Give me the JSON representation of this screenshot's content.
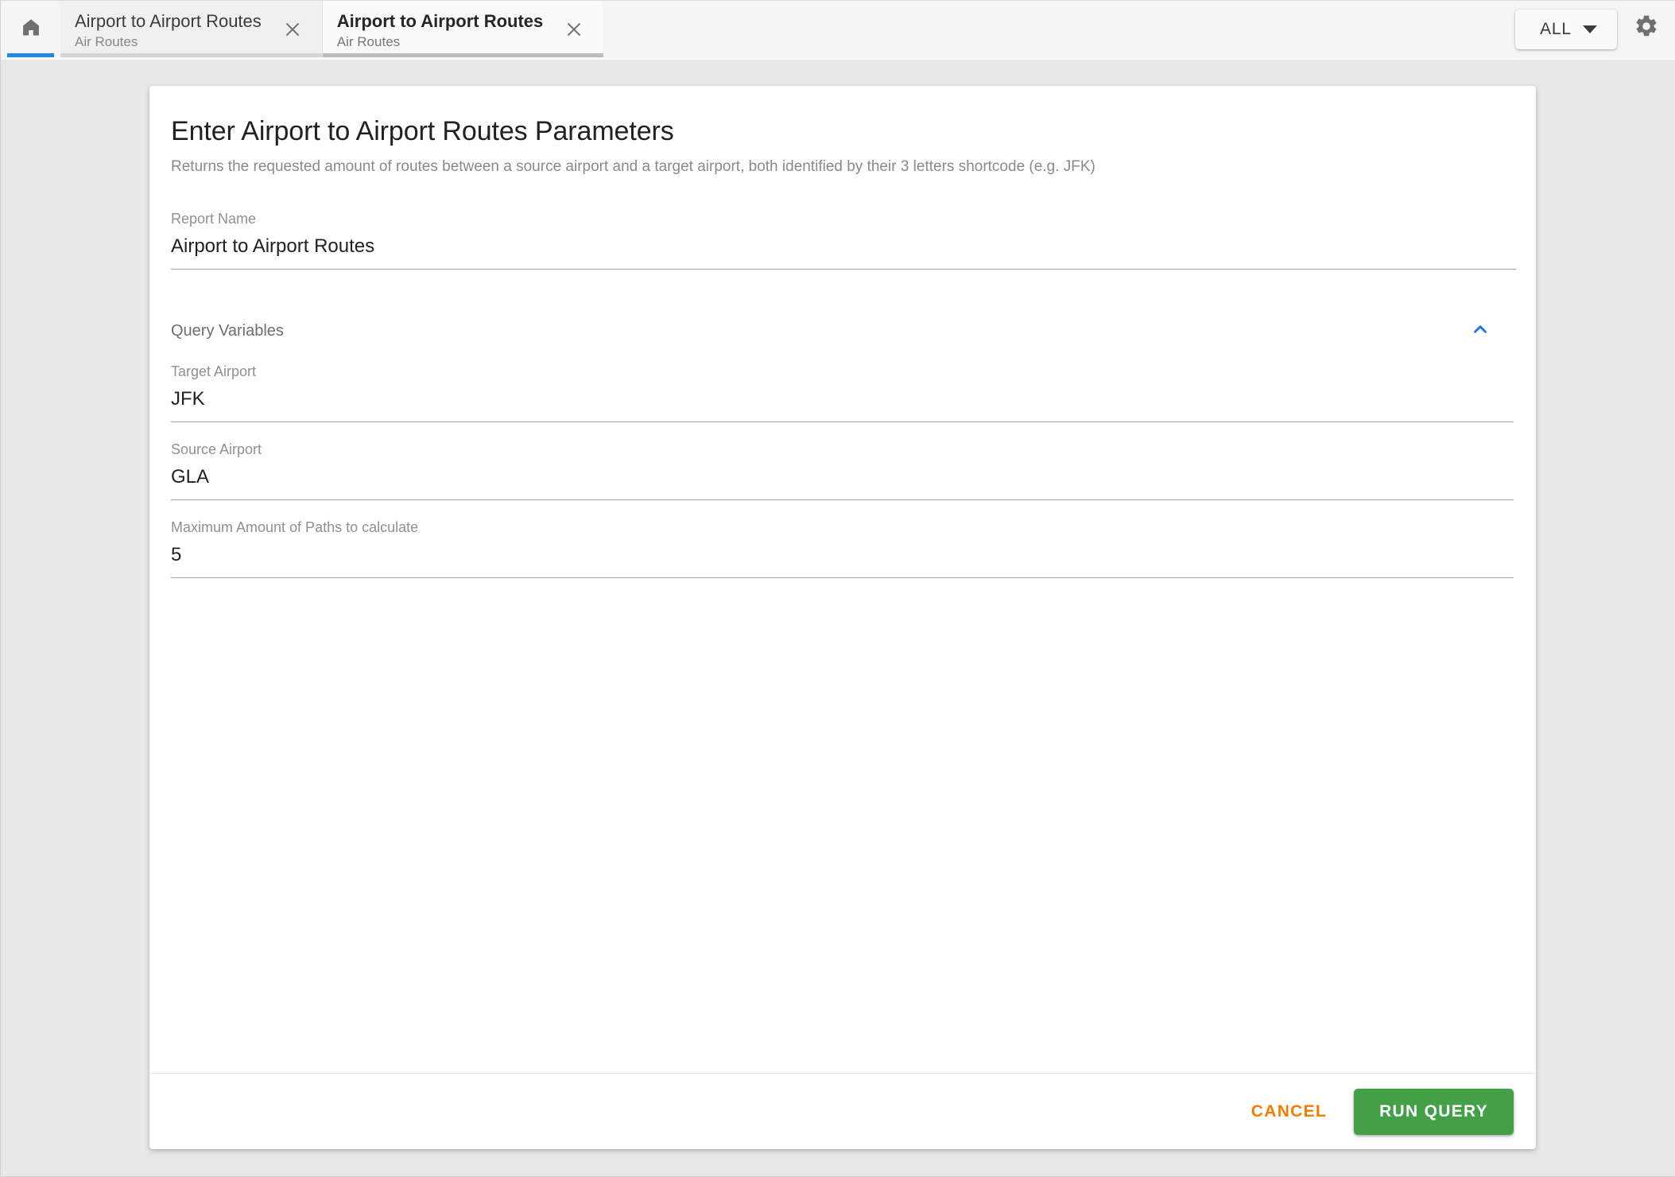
{
  "header": {
    "home_icon": "home-icon",
    "tabs": [
      {
        "title": "Airport to Airport Routes",
        "subtitle": "Air Routes",
        "active": false,
        "close_icon": "close-icon"
      },
      {
        "title": "Airport to Airport Routes",
        "subtitle": "Air Routes",
        "active": true,
        "close_icon": "close-icon"
      }
    ],
    "filter": {
      "label": "ALL",
      "caret_icon": "chevron-down-icon"
    },
    "settings_icon": "gear-icon",
    "active_indicator_color": "#1e88e5"
  },
  "card": {
    "title": "Enter Airport to Airport Routes Parameters",
    "description": "Returns the requested amount of routes between a source airport and a target airport, both identified by their 3 letters shortcode (e.g. JFK)",
    "report_name": {
      "label": "Report Name",
      "value": "Airport to Airport Routes",
      "placeholder": "Report Name"
    },
    "query_variables": {
      "section_label": "Query Variables",
      "collapse_icon": "chevron-up-icon",
      "collapse_icon_color": "#1a73e8",
      "expanded": true,
      "fields": [
        {
          "label": "Target Airport",
          "value": "JFK",
          "placeholder": "Target Airport"
        },
        {
          "label": "Source Airport",
          "value": "GLA",
          "placeholder": "Source Airport"
        },
        {
          "label": "Maximum Amount of Paths to calculate",
          "value": "5",
          "placeholder": "Maximum Amount of Paths to calculate"
        }
      ]
    },
    "footer": {
      "cancel_label": "CANCEL",
      "cancel_color": "#f57c00",
      "run_label": "RUN QUERY",
      "run_color": "#43a047"
    }
  }
}
